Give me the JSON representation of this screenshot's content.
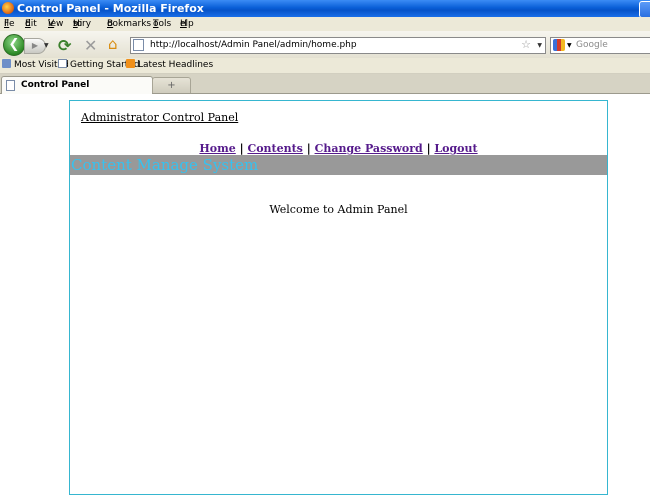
{
  "window": {
    "title": "Control Panel - Mozilla Firefox"
  },
  "menubar": {
    "items": [
      {
        "label": "File",
        "accel": "F",
        "rest": "ile"
      },
      {
        "label": "Edit",
        "accel": "E",
        "rest": "dit"
      },
      {
        "label": "View",
        "accel": "V",
        "rest": "iew"
      },
      {
        "label": "History",
        "pre": "Hi",
        "accel": "s",
        "rest": "tory"
      },
      {
        "label": "Bookmarks",
        "accel": "B",
        "rest": "ookmarks"
      },
      {
        "label": "Tools",
        "accel": "T",
        "rest": "ools"
      },
      {
        "label": "Help",
        "accel": "H",
        "rest": "elp"
      }
    ]
  },
  "navbar": {
    "url": "http://localhost/Admin Panel/admin/home.php",
    "search_placeholder": "Google"
  },
  "bookmarks": {
    "items": [
      "Most Visited",
      "Getting Started",
      "Latest Headlines"
    ]
  },
  "tabs": {
    "active_label": "Control Panel",
    "new_tab_symbol": "+"
  },
  "page": {
    "admin_title": "Administrator Control Panel",
    "nav": {
      "home": "Home",
      "contents": "Contents",
      "change_password": "Change Password",
      "logout": "Logout",
      "separator": " | "
    },
    "cms_title": "Content Manage System",
    "welcome": "Welcome to Admin Panel"
  },
  "colors": {
    "panel_border": "#36b6d0",
    "cms_bar": "#999999",
    "cms_text": "#35c2f0",
    "visited_link": "#551a8b"
  }
}
